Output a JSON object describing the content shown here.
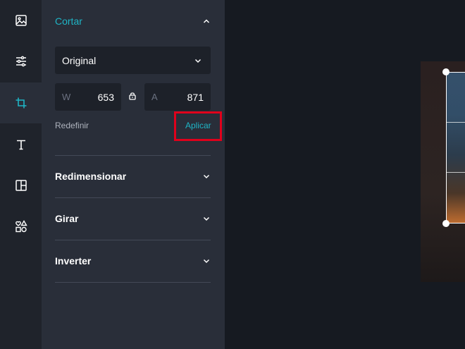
{
  "toolbar": {
    "items": [
      {
        "name": "image-tool",
        "icon": "image-icon"
      },
      {
        "name": "adjust-tool",
        "icon": "sliders-icon"
      },
      {
        "name": "crop-tool",
        "icon": "crop-icon",
        "active": true
      },
      {
        "name": "text-tool",
        "icon": "text-icon"
      },
      {
        "name": "layout-tool",
        "icon": "layout-icon"
      },
      {
        "name": "elements-tool",
        "icon": "shapes-icon"
      }
    ]
  },
  "panel": {
    "crop": {
      "title": "Cortar",
      "aspect_select": "Original",
      "width_label": "W",
      "width_value": "653",
      "height_label": "A",
      "height_value": "871",
      "reset_label": "Redefinir",
      "apply_label": "Aplicar"
    },
    "sections": [
      {
        "label": "Redimensionar"
      },
      {
        "label": "Girar"
      },
      {
        "label": "Inverter"
      }
    ]
  },
  "colors": {
    "accent": "#1fb5c6",
    "highlight": "#e0001b",
    "panel_bg": "#292e39",
    "rail_bg": "#1f232b",
    "canvas_bg": "#161a21"
  }
}
